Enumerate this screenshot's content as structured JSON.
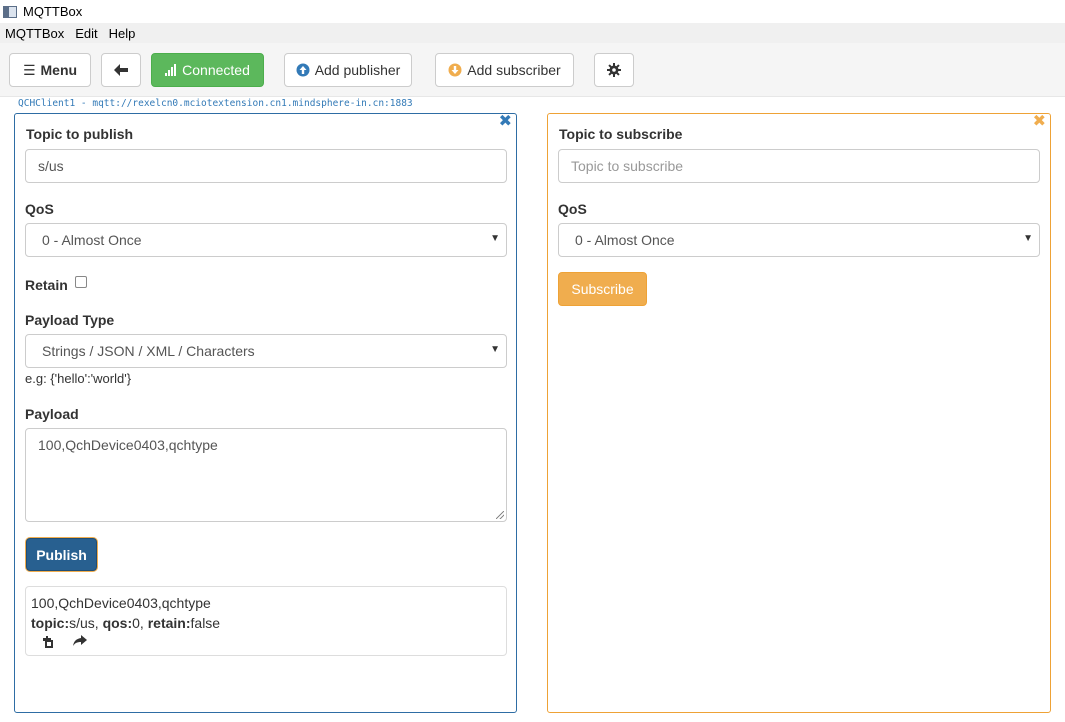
{
  "window": {
    "title": "MQTTBox"
  },
  "menubar": [
    "MQTTBox",
    "Edit",
    "Help"
  ],
  "toolbar": {
    "menu_label": "Menu",
    "status_label": "Connected",
    "add_publisher_label": "Add publisher",
    "add_subscriber_label": "Add subscriber"
  },
  "connection": {
    "url": "QCHClient1 - mqtt://rexelcn0.mciotextension.cn1.mindsphere-in.cn:1883"
  },
  "publisher": {
    "topic_label": "Topic to publish",
    "topic_value": "s/us",
    "qos_label": "QoS",
    "qos_value": "0 - Almost Once",
    "retain_label": "Retain",
    "retain_checked": false,
    "payload_type_label": "Payload Type",
    "payload_type_value": "Strings / JSON / XML / Characters",
    "payload_hint": "e.g: {'hello':'world'}",
    "payload_label": "Payload",
    "payload_value": "100,QchDevice0403,qchtype",
    "publish_label": "Publish",
    "message": {
      "payload": "100,QchDevice0403,qchtype",
      "topic_key": "topic:",
      "topic_val": "s/us,",
      "qos_key": "qos:",
      "qos_val": "0,",
      "retain_key": "retain:",
      "retain_val": "false"
    }
  },
  "subscriber": {
    "topic_label": "Topic to subscribe",
    "topic_placeholder": "Topic to subscribe",
    "qos_label": "QoS",
    "qos_value": "0 - Almost Once",
    "subscribe_label": "Subscribe"
  },
  "colors": {
    "publisher_accent": "#2e6da4",
    "subscriber_accent": "#eea236",
    "connected_green": "#5cb85c",
    "link_blue": "#337ab7"
  }
}
